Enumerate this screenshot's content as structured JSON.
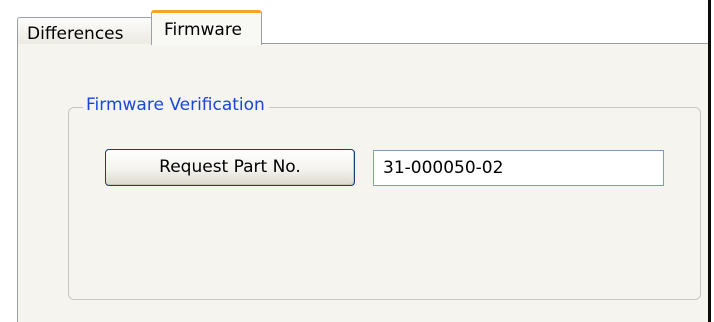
{
  "tabs": {
    "differences_label": "Differences",
    "firmware_label": "Firmware"
  },
  "firmware_verification": {
    "group_title": "Firmware Verification",
    "request_button_label": "Request Part No.",
    "part_number_value": "31-000050-02"
  },
  "colors": {
    "active_tab_accent": "#f4a428",
    "group_title_color": "#1a47d8",
    "panel_background": "#f5f4ee"
  }
}
